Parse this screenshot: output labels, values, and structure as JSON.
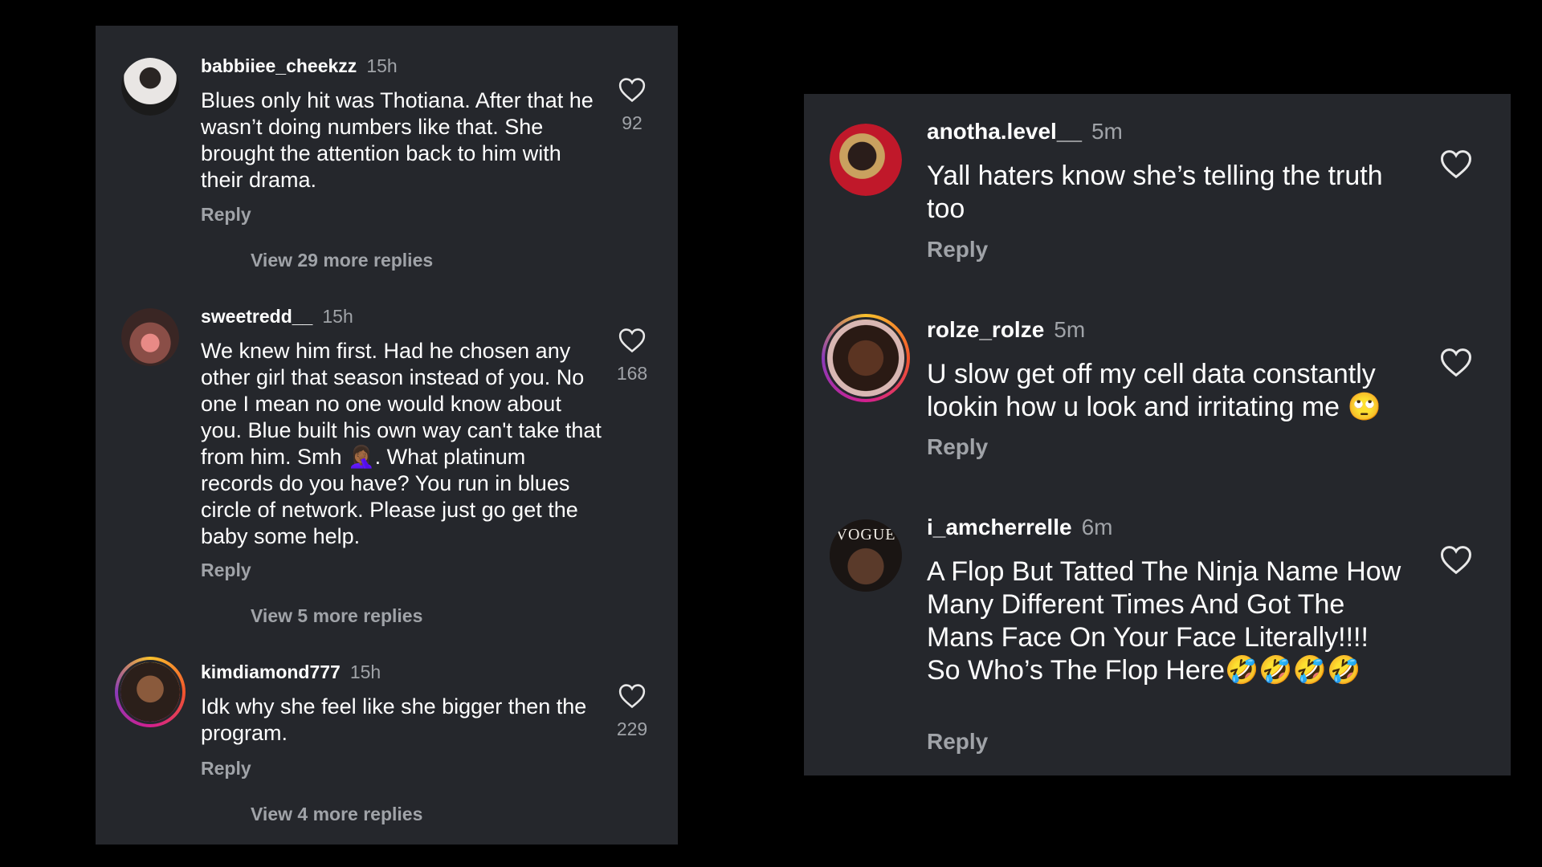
{
  "left_panel": {
    "comments": [
      {
        "username": "babbiiee_cheekzz",
        "time": "15h",
        "text": "Blues only hit was Thotiana. After that he wasn’t doing numbers like that. She brought the attention back to him with their drama.",
        "reply_label": "Reply",
        "view_more": "View 29 more replies",
        "likes": "92"
      },
      {
        "username": "sweetredd__",
        "time": "15h",
        "text": "We knew him first. Had he chosen any other girl that season instead of you. No one I mean no one would know about you. Blue built his own way can't take that from him. Smh 🤦🏾‍♀️. What platinum records do you have? You run in blues circle of network. Please just go get the baby some help.",
        "reply_label": "Reply",
        "view_more": "View 5 more replies",
        "likes": "168"
      },
      {
        "username": "kimdiamond777",
        "time": "15h",
        "text": "Idk why she feel like she bigger then the program.",
        "reply_label": "Reply",
        "view_more": "View 4 more replies",
        "likes": "229"
      }
    ]
  },
  "right_panel": {
    "comments": [
      {
        "username": "anotha.level__",
        "time": "5m",
        "text": "Yall haters know she’s telling the truth too",
        "reply_label": "Reply"
      },
      {
        "username": "rolze_rolze",
        "time": "5m",
        "text": "U slow get off my cell data constantly lookin how u look and irritating me 🙄",
        "reply_label": "Reply"
      },
      {
        "username": "i_amcherrelle",
        "time": "6m",
        "text": "A Flop But Tatted The Ninja Name How Many Different Times And Got The Mans Face On Your Face Literally!!!! So Who’s The Flop Here🤣🤣🤣🤣",
        "reply_label": "Reply",
        "avatar_text": "VOGUE"
      }
    ]
  },
  "icons": {
    "like": "heart-outline-icon"
  },
  "colors": {
    "background": "#000000",
    "panel": "#25272c",
    "text_primary": "#ffffff",
    "text_secondary": "#a0a3a8"
  }
}
